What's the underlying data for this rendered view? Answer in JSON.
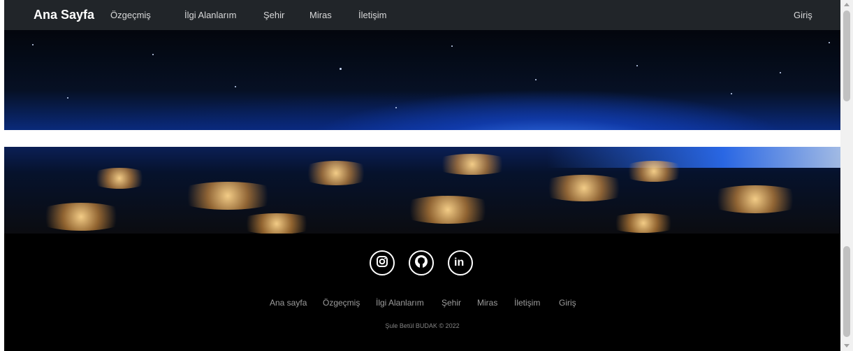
{
  "navbar": {
    "brand": "Ana Sayfa",
    "links": [
      "Özgeçmiş",
      "İlgi Alanlarım",
      "Şehir",
      "Miras",
      "İletişim"
    ],
    "login": "Giriş"
  },
  "footer": {
    "social": [
      "instagram-icon",
      "github-icon",
      "linkedin-icon"
    ],
    "links": [
      "Ana sayfa",
      "Özgeçmiş",
      "İlgi Alanlarım",
      "Şehir",
      "Miras",
      "İletişim",
      "Giriş"
    ],
    "copyright": "Şule Betül BUDAK © 2022"
  },
  "colors": {
    "navbar_bg": "#212529",
    "footer_bg": "#000000",
    "hero_blue": "#2f74ff"
  }
}
